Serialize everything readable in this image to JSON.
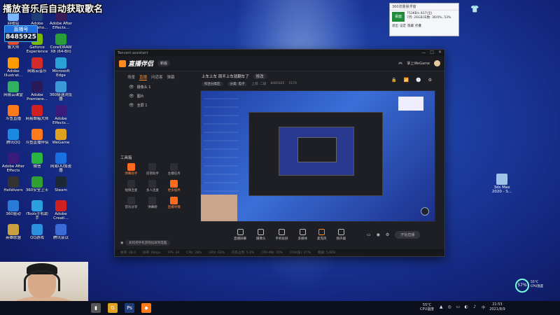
{
  "overlay": {
    "title": "播放音乐后自动获取歌名",
    "viewer_label": "直播号",
    "viewer_num": "8485925"
  },
  "desktop_icons": [
    {
      "label": "回收站",
      "color": "#7ab7ff"
    },
    {
      "label": "Adobe Photosho...",
      "color": "#1d3c7a"
    },
    {
      "label": "Adobe After Effects...",
      "color": "#3b1a5a"
    },
    {
      "label": "鲁大师",
      "color": "#e84a2a"
    },
    {
      "label": "Geforce Experience",
      "color": "#76b900"
    },
    {
      "label": "CorelDRAW X8 (64-Bit)",
      "color": "#2a9d3a"
    },
    {
      "label": "Adobe Illustrat...",
      "color": "#ff9a00"
    },
    {
      "label": "网易云音乐",
      "color": "#d42a2a"
    },
    {
      "label": "Microsoft Edge",
      "color": "#2aa0d4"
    },
    {
      "label": "网易云课堂",
      "color": "#30b060"
    },
    {
      "label": "Adobe Premiere...",
      "color": "#2a1a5a"
    },
    {
      "label": "360极速浏览器",
      "color": "#3a9ad8"
    },
    {
      "label": "斗鱼直播",
      "color": "#ff7a1a"
    },
    {
      "label": "网易邮箱大师",
      "color": "#d02020"
    },
    {
      "label": "Adobe Effects...",
      "color": "#3a1a7a"
    },
    {
      "label": "腾讯QQ",
      "color": "#1a8ae0"
    },
    {
      "label": "斗鱼直播伴侣",
      "color": "#ff7a1a"
    },
    {
      "label": "WeGame",
      "color": "#e0a020"
    },
    {
      "label": "Adobe After Effects",
      "color": "#3a1a7a"
    },
    {
      "label": "微信",
      "color": "#2ab540"
    },
    {
      "label": "网易UU加速器",
      "color": "#1a70e0"
    },
    {
      "label": "Helldivers",
      "color": "#333333"
    },
    {
      "label": "360安全卫士",
      "color": "#30a030"
    },
    {
      "label": "Steam",
      "color": "#1b2838"
    },
    {
      "label": "360驱动",
      "color": "#2a7ad8"
    },
    {
      "label": "iTools手机助手",
      "color": "#2aa0e0"
    },
    {
      "label": "Adobe Creati...",
      "color": "#d02020"
    },
    {
      "label": "英雄联盟",
      "color": "#c8a040"
    },
    {
      "label": "QQ游戏",
      "color": "#2a90e0"
    },
    {
      "label": "腾讯会议",
      "color": "#3a6ad8"
    }
  ],
  "right_icon": {
    "label": "3ds Max 2020 - S..."
  },
  "net_widget": {
    "header": "360流量悬浮窗",
    "monitor": "桌面",
    "stats": [
      "753KB/s 837(全)",
      "7月: 26GB/天数: 36/0%, 53%"
    ],
    "buttons": [
      "退出",
      "设定",
      "隐藏",
      "折叠"
    ]
  },
  "app": {
    "window_title": "Tencent assistant",
    "window_controls": [
      "一",
      "□",
      "✕"
    ],
    "brand": "直播伴侣",
    "version": "新版",
    "user": "掌上WeGame",
    "tabs": [
      "场景",
      "直播",
      "问道客",
      "弹幕"
    ],
    "active_tab": 1,
    "scenes": [
      "摄像头 1",
      "图片",
      "全屏 1"
    ],
    "stream_title": "上车上车 周不上车就翻车了",
    "edit_label": "修改",
    "meta": [
      "综合分类区",
      "分类: 电子",
      "上周: 二级",
      "8485925",
      "5170"
    ],
    "tools_title": "工具箱",
    "tools": [
      {
        "label": "弹幕助手",
        "orange": true
      },
      {
        "label": "房管助手",
        "orange": false
      },
      {
        "label": "主播任务",
        "orange": false
      },
      {
        "label": "视频连麦",
        "orange": false
      },
      {
        "label": "多人连麦",
        "orange": false
      },
      {
        "label": "更多插件",
        "orange": true
      },
      {
        "label": "音乐分享",
        "orange": false
      },
      {
        "label": "弹幕姬",
        "orange": false
      },
      {
        "label": "直播导播",
        "orange": true
      }
    ],
    "tools_bottom_label": "如何把手机游戏投屏到电脑",
    "right_tools": [
      "🔒",
      "📶",
      "🕒",
      "⚙"
    ],
    "controls": [
      {
        "label": "直播屏幕",
        "mic": false
      },
      {
        "label": "摄像头",
        "mic": false
      },
      {
        "label": "手机投屏",
        "mic": false
      },
      {
        "label": "多媒体",
        "mic": false
      },
      {
        "label": "麦克风",
        "mic": true
      },
      {
        "label": "扬声器",
        "mic": false
      }
    ],
    "start_label": "开始直播",
    "status": [
      "帧率: 28.0",
      "码率: 0kbps",
      "FPS: 30",
      "CPU: 28%",
      "GPU: 63%",
      "内存占用: 5.4%",
      "CPU-MB: 70%",
      "CPU(核): 47%",
      "网速: 5.6KB"
    ]
  },
  "cpu_gadget": {
    "percent": "57%",
    "line1": "55°C",
    "line2": "CPU温度"
  },
  "taskbar": {
    "apps": [
      {
        "glyph": "▮",
        "color": "#555555"
      },
      {
        "glyph": "G",
        "color": "#e0a020"
      },
      {
        "glyph": "Ps",
        "color": "#1d3c7a"
      },
      {
        "glyph": "◆",
        "color": "#ff7a1a"
      }
    ],
    "temp_value": "55°C",
    "temp_label": "CPU温度",
    "tray_icons": [
      "▲",
      "◎",
      "▭",
      "◐",
      "♪"
    ],
    "ime": "中",
    "time": "21:53",
    "date": "2021/8/9"
  }
}
